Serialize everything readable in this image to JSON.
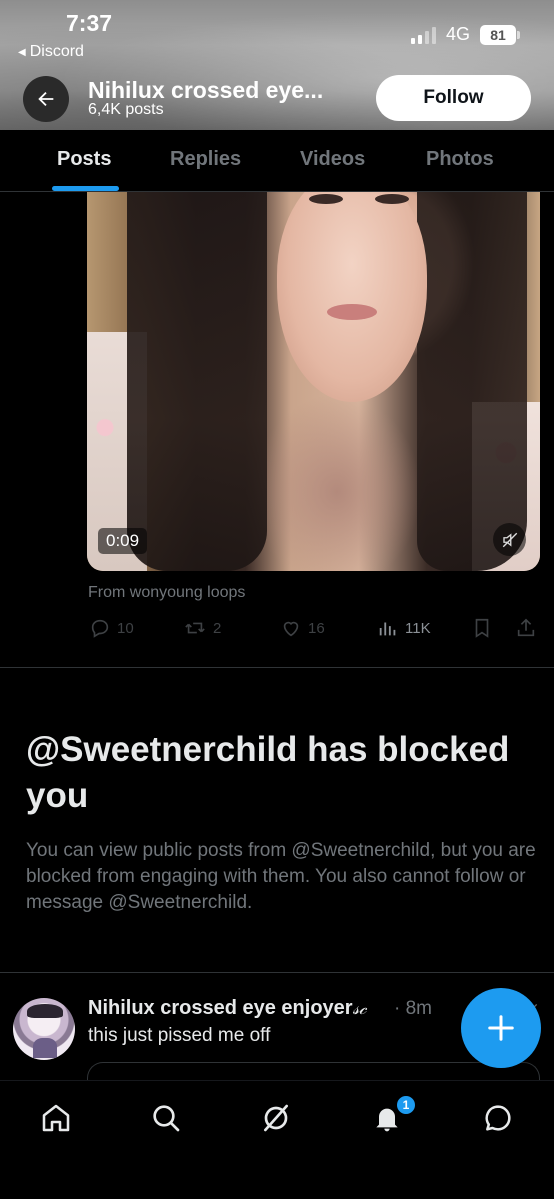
{
  "status_bar": {
    "time": "7:37",
    "back_app": "Discord",
    "network": "4G",
    "battery": "81"
  },
  "profile": {
    "name": "Nihilux crossed eye...",
    "posts_count": "6,4K posts",
    "follow_label": "Follow"
  },
  "tabs": [
    {
      "label": "Posts",
      "active": true
    },
    {
      "label": "Replies",
      "active": false
    },
    {
      "label": "Videos",
      "active": false
    },
    {
      "label": "Photos",
      "active": false
    }
  ],
  "media_post": {
    "video_time": "0:09",
    "source": "From wonyoung loops",
    "replies": "10",
    "reposts": "2",
    "likes": "16",
    "views": "11K"
  },
  "blocked": {
    "title": "@Sweetnerchild has blocked you",
    "description": "You can view public posts from @Sweetnerchild, but you are blocked from engaging with them. You also cannot follow or message @Sweetnerchild."
  },
  "bottom_post": {
    "author": "Nihilux crossed eye enjoyer",
    "author_decor": "𝓈𝒸",
    "time": "· 8m",
    "text": "this just pissed me off"
  },
  "nav": {
    "notifications_badge": "1",
    "icons": [
      "home-icon",
      "search-icon",
      "grok-icon",
      "bell-icon",
      "messages-icon"
    ]
  },
  "colors": {
    "accent": "#1d9bf0",
    "background": "#000000",
    "text_primary": "#e7e9ea",
    "text_secondary": "#71767b"
  }
}
